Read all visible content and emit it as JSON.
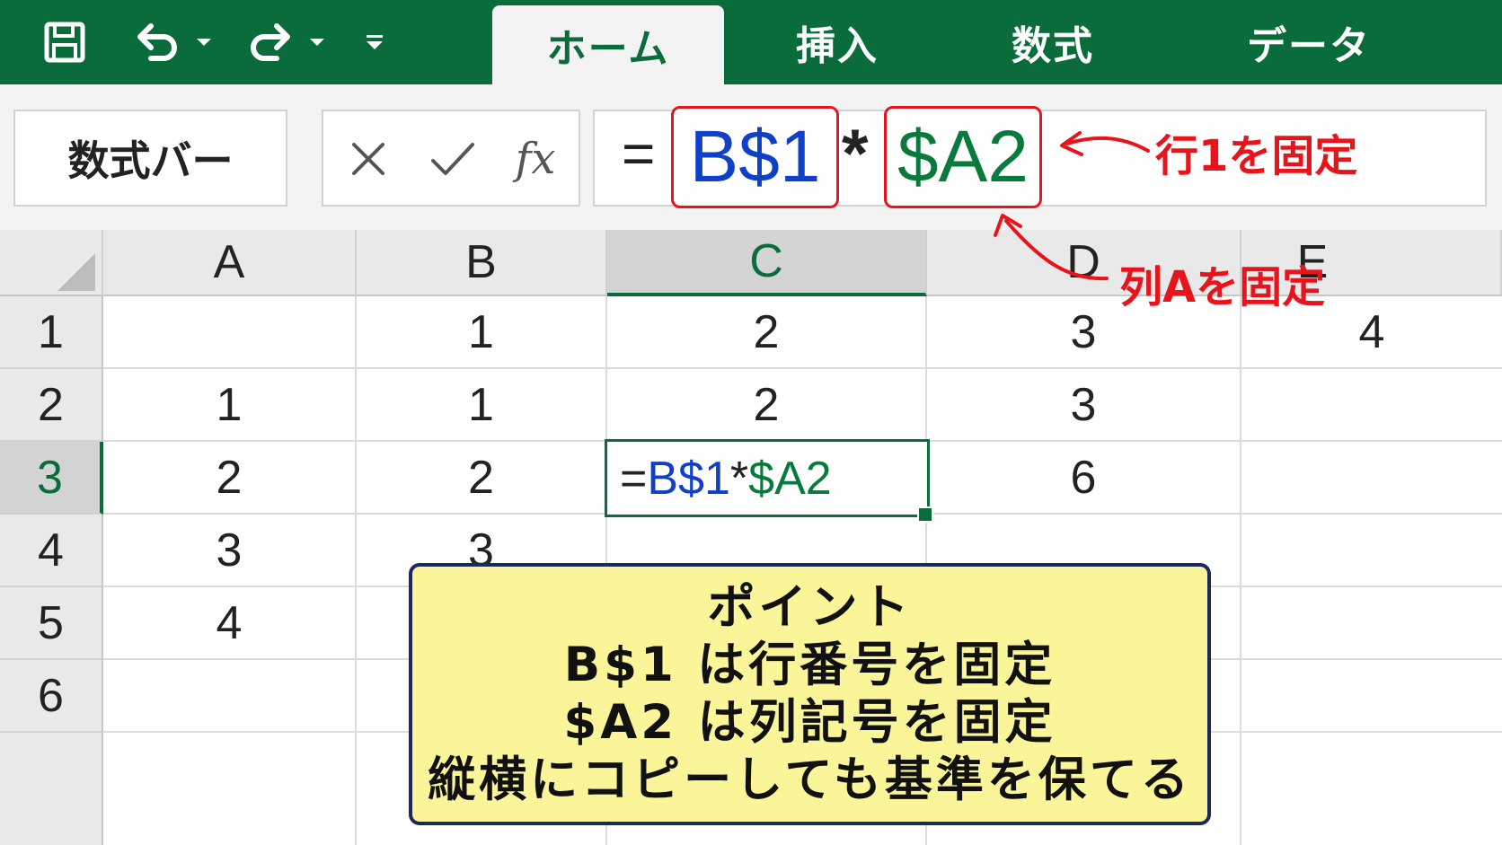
{
  "colors": {
    "ribbon": "#0a6b3b",
    "ref_blue": "#1040c8",
    "ref_green": "#0a7a3c",
    "annotation_red": "#e8141c",
    "callout_bg": "#fbf59a",
    "callout_border": "#1a2a5c"
  },
  "quick_access": {
    "icons": [
      "save-icon",
      "undo-icon",
      "undo-dropdown-icon",
      "redo-icon",
      "redo-dropdown-icon",
      "customize-quick-access-icon"
    ]
  },
  "tabs": [
    {
      "label": "ホーム",
      "active": true
    },
    {
      "label": "挿入",
      "active": false
    },
    {
      "label": "数式",
      "active": false
    },
    {
      "label": "データ",
      "active": false
    }
  ],
  "namebox": {
    "label": "数式バー"
  },
  "formula_buttons": {
    "fx_label": "fx"
  },
  "formula": {
    "equals": "=",
    "ref1": "B$1",
    "operator": "*",
    "ref2": "$A2"
  },
  "annotations": {
    "row_fixed": "行1を固定",
    "col_fixed": "列Aを固定"
  },
  "sheet": {
    "columns": [
      "A",
      "B",
      "C",
      "D",
      "E"
    ],
    "rows": [
      "1",
      "2",
      "3",
      "4",
      "5",
      "6"
    ],
    "cells": [
      [
        "",
        "1",
        "2",
        "3",
        "4"
      ],
      [
        "1",
        "1",
        "2",
        "3",
        ""
      ],
      [
        "2",
        "2",
        "",
        "6",
        ""
      ],
      [
        "3",
        "3",
        "",
        "",
        ""
      ],
      [
        "4",
        "",
        "",
        "",
        ""
      ],
      [
        "",
        "",
        "",
        "",
        ""
      ]
    ],
    "active_cell": {
      "ref": "C3",
      "formula_eq": "=",
      "formula_ref1": "B$1",
      "formula_op": "*",
      "formula_ref2": "$A2"
    }
  },
  "callout": {
    "lines": [
      "ポイント",
      "B$1 は行番号を固定",
      "$A2 は列記号を固定",
      "縦横にコピーしても基準を保てる"
    ]
  }
}
